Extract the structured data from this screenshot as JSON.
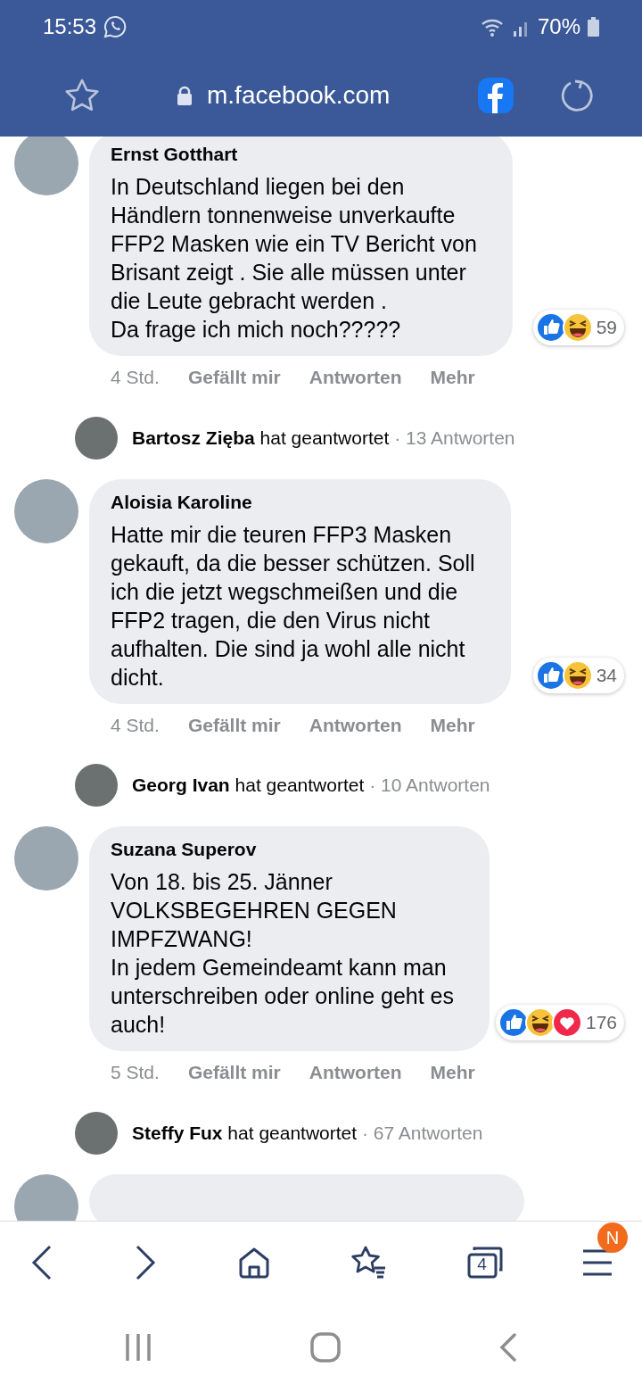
{
  "status_bar": {
    "time": "15:53",
    "battery": "70%"
  },
  "browser_bar": {
    "url": "m.facebook.com"
  },
  "comments": [
    {
      "author": "Ernst Gotthart",
      "text": "In Deutschland liegen bei den\nHändlern tonnenweise unverkaufte\nFFP2 Masken wie ein TV Bericht von\nBrisant zeigt . Sie alle müssen unter\ndie Leute gebracht werden .\nDa frage ich mich noch?????",
      "reactions": [
        {
          "kind": "like"
        },
        {
          "kind": "haha"
        }
      ],
      "reaction_count": "59",
      "time": "4 Std.",
      "actions": [
        "Gefällt mir",
        "Antworten",
        "Mehr"
      ],
      "reply_summary": {
        "name": "Bartosz Zięba",
        "verb": "hat geantwortet",
        "count": "· 13 Antworten"
      }
    },
    {
      "author": "Aloisia Karoline",
      "text": "Hatte mir die teuren FFP3 Masken\ngekauft, da die besser schützen. Soll\nich die jetzt wegschmeißen und die\nFFP2 tragen, die den Virus nicht\naufhalten. Die sind ja wohl alle nicht\ndicht.",
      "reactions": [
        {
          "kind": "like"
        },
        {
          "kind": "haha"
        }
      ],
      "reaction_count": "34",
      "time": "4 Std.",
      "actions": [
        "Gefällt mir",
        "Antworten",
        "Mehr"
      ],
      "reply_summary": {
        "name": "Georg Ivan",
        "verb": "hat geantwortet",
        "count": "· 10 Antworten"
      }
    },
    {
      "author": "Suzana Superov",
      "text": "Von 18. bis 25. Jänner\nVOLKSBEGEHREN GEGEN\nIMPFZWANG!\nIn jedem Gemeindeamt kann man\nunterschreiben oder online geht es\nauch!",
      "reactions": [
        {
          "kind": "like"
        },
        {
          "kind": "haha"
        },
        {
          "kind": "love"
        }
      ],
      "reaction_count": "176",
      "time": "5 Std.",
      "actions": [
        "Gefällt mir",
        "Antworten",
        "Mehr"
      ],
      "reply_summary": {
        "name": "Steffy Fux",
        "verb": "hat geantwortet",
        "count": "· 67 Antworten"
      }
    }
  ],
  "bottom_toolbar": {
    "tab_count": "4",
    "menu_badge": "N"
  }
}
